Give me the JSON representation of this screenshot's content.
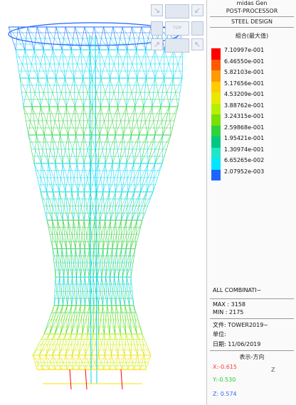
{
  "panel": {
    "app_name": "midas Gen",
    "mode": "POST-PROCESSOR",
    "design_type": "STEEL DESIGN",
    "result_label": "組合(最大值)",
    "legend": {
      "values": [
        "7.10997e-001",
        "6.46550e-001",
        "5.82103e-001",
        "5.17656e-001",
        "4.53209e-001",
        "3.88762e-001",
        "3.24315e-001",
        "2.59868e-001",
        "1.95421e-001",
        "1.30974e-001",
        "6.65265e-002",
        "2.07952e-003"
      ],
      "colors": [
        "#ff0000",
        "#ff5a00",
        "#ff9a00",
        "#ffcc00",
        "#e8e800",
        "#b4f000",
        "#78e000",
        "#2ed23c",
        "#00c882",
        "#20e6c8",
        "#00e6ff",
        "#1e64ff"
      ]
    },
    "combination": "ALL COMBINATI~",
    "max_label": "MAX : 3158",
    "min_label": "MIN : 2175",
    "file_label": "文件: TOWER2019~",
    "unit_label": "单位:",
    "date_label": "日期: 11/06/2019",
    "view_direction_title": "表示-方向",
    "view_x": "X:-0.615",
    "view_y": "Y:-0.530",
    "view_z": "Z: 0.574",
    "axis_z": "Z"
  },
  "viewport": {
    "view_cube_label": "TOP",
    "colors": {
      "blue": "#1e64ff",
      "cyan": "#00d8f0",
      "green": "#2ed23c",
      "lime": "#a8f000",
      "yellow": "#ffe000",
      "red": "#ff0000"
    }
  }
}
